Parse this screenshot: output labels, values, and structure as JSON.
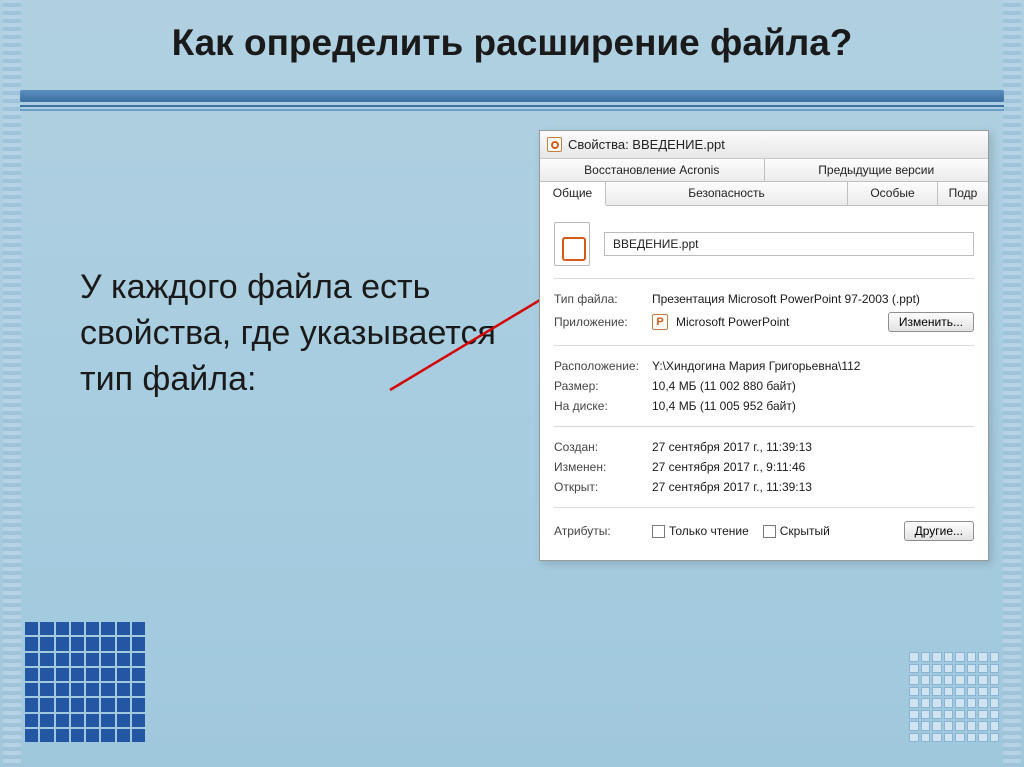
{
  "slide": {
    "title": "Как определить расширение файла?",
    "body": "У каждого файла есть свойства, где указывается тип файла:"
  },
  "dialog": {
    "title": "Свойства: ВВЕДЕНИЕ.ppt",
    "tabs_top": {
      "restore": "Восстановление Acronis",
      "prev_versions": "Предыдущие версии"
    },
    "tabs_bottom": {
      "general": "Общие",
      "security": "Безопасность",
      "special": "Особые",
      "details": "Подр"
    },
    "filename": "ВВЕДЕНИЕ.ppt",
    "labels": {
      "filetype": "Тип файла:",
      "app": "Приложение:",
      "location": "Расположение:",
      "size": "Размер:",
      "ondisk": "На диске:",
      "created": "Создан:",
      "modified": "Изменен:",
      "opened": "Открыт:",
      "attrs": "Атрибуты:"
    },
    "values": {
      "filetype": "Презентация Microsoft PowerPoint 97-2003 (.ppt)",
      "app": "Microsoft PowerPoint",
      "location": "Y:\\Хиндогина Мария Григорьевна\\112",
      "size": "10,4 МБ (11 002 880 байт)",
      "ondisk": "10,4 МБ (11 005 952 байт)",
      "created": "27 сентября 2017 г., 11:39:13",
      "modified": "27 сентября 2017 г., 9:11:46",
      "opened": "27 сентября 2017 г., 11:39:13"
    },
    "buttons": {
      "change": "Изменить...",
      "other": "Другие..."
    },
    "attrs": {
      "readonly": "Только чтение",
      "hidden": "Скрытый"
    }
  }
}
